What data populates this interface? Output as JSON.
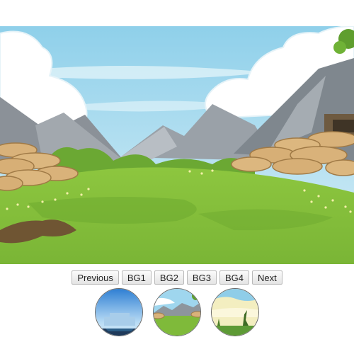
{
  "scene": {
    "description_icon": "landscape-background"
  },
  "controls": {
    "buttons": [
      "Previous",
      "BG1",
      "BG2",
      "BG3",
      "BG4",
      "Next"
    ]
  },
  "thumbnails": [
    {
      "icon": "bg1-thumbnail"
    },
    {
      "icon": "bg2-thumbnail"
    },
    {
      "icon": "bg3-thumbnail"
    }
  ],
  "colors": {
    "sky": "#bfe4f3",
    "grass": "#7fba3a",
    "mountain": "#8f979e",
    "rocks": "#d9b27a"
  }
}
